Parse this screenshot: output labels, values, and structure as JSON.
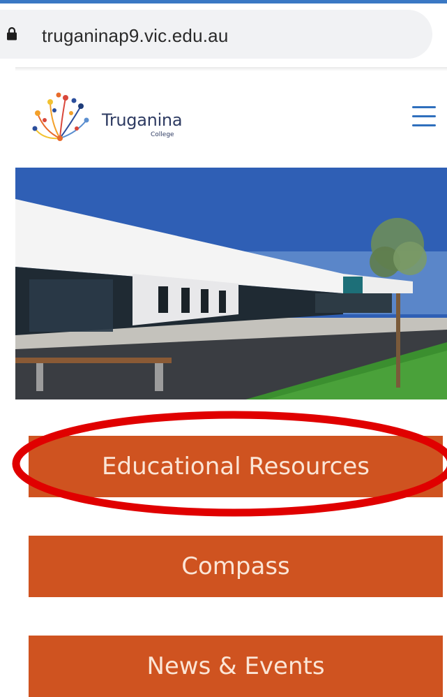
{
  "browser": {
    "url": "truganinap9.vic.edu.au",
    "lock_icon": "lock-icon"
  },
  "header": {
    "logo_name": "Truganina",
    "logo_subtitle": "College",
    "menu_icon": "hamburger-menu-icon"
  },
  "hero": {
    "image": "school-building-photo"
  },
  "buttons": [
    {
      "label": "Educational Resources"
    },
    {
      "label": "Compass"
    },
    {
      "label": "News & Events"
    }
  ],
  "annotation": {
    "color": "#e00000",
    "highlights": "Educational Resources"
  },
  "colors": {
    "button_bg": "#cf5320",
    "button_text": "#fbe5d6",
    "menu_accent": "#2f6fbd",
    "brand_text": "#2e3b62"
  }
}
